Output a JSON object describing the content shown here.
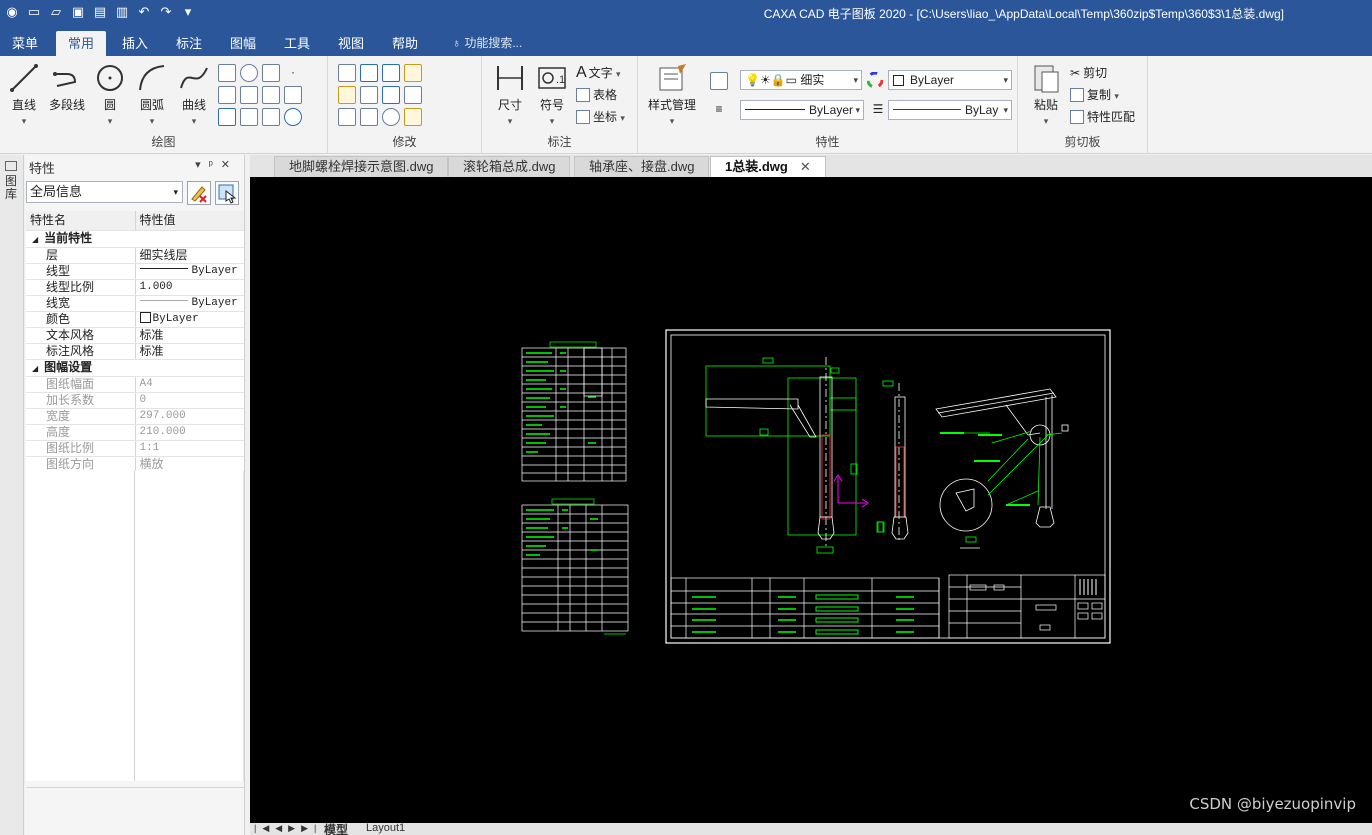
{
  "app": {
    "title": "CAXA CAD 电子图板 2020 - [C:\\Users\\liao_\\AppData\\Local\\Temp\\360zip$Temp\\360$3\\1总装.dwg]",
    "brand_color": "#2b579a"
  },
  "menu": {
    "tabs": [
      "菜单",
      "常用",
      "插入",
      "标注",
      "图幅",
      "工具",
      "视图",
      "帮助"
    ],
    "active": "常用",
    "search_placeholder": "功能搜索..."
  },
  "ribbon": {
    "draw": {
      "label": "绘图",
      "buttons": [
        "直线",
        "多段线",
        "圆",
        "圆弧",
        "曲线"
      ]
    },
    "modify": {
      "label": "修改"
    },
    "annotate": {
      "label": "标注",
      "buttons": [
        "尺寸",
        "符号"
      ],
      "small": [
        "文字",
        "表格",
        "坐标"
      ]
    },
    "properties": {
      "label": "特性",
      "style_button": "样式管理",
      "layer_combo": "细实",
      "color_combo": "ByLayer",
      "linetype_combo": "ByLayer",
      "lineweight_combo": "ByLay"
    },
    "clipboard": {
      "label": "剪切板",
      "paste": "粘贴",
      "small": [
        "剪切",
        "复制",
        "特性匹配"
      ]
    }
  },
  "side_strip": {
    "label": "图库"
  },
  "properties_panel": {
    "title": "特性",
    "scope": "全局信息",
    "header": {
      "name": "特性名",
      "value": "特性值"
    },
    "sections": [
      {
        "name": "当前特性",
        "rows": [
          {
            "key": "层",
            "value": "细实线层"
          },
          {
            "key": "线型",
            "value": "ByLayer"
          },
          {
            "key": "线型比例",
            "value": "1.000"
          },
          {
            "key": "线宽",
            "value": "ByLayer"
          },
          {
            "key": "颜色",
            "value": "ByLayer"
          },
          {
            "key": "文本风格",
            "value": "标准"
          },
          {
            "key": "标注风格",
            "value": "标准"
          }
        ]
      },
      {
        "name": "图幅设置",
        "rows": [
          {
            "key": "图纸幅面",
            "value": "A4"
          },
          {
            "key": "加长系数",
            "value": "0"
          },
          {
            "key": "宽度",
            "value": "297.000"
          },
          {
            "key": "高度",
            "value": "210.000"
          },
          {
            "key": "图纸比例",
            "value": "1:1"
          },
          {
            "key": "图纸方向",
            "value": "横放"
          }
        ]
      }
    ]
  },
  "documents": {
    "tabs": [
      "地脚螺栓焊接示意图.dwg",
      "滚轮箱总成.dwg",
      "轴承座、接盘.dwg",
      "1总装.dwg"
    ],
    "active": "1总装.dwg"
  },
  "layout_tabs": {
    "model": "模型",
    "layout": "Layout1"
  },
  "watermark": "CSDN @biyezuopinvip"
}
